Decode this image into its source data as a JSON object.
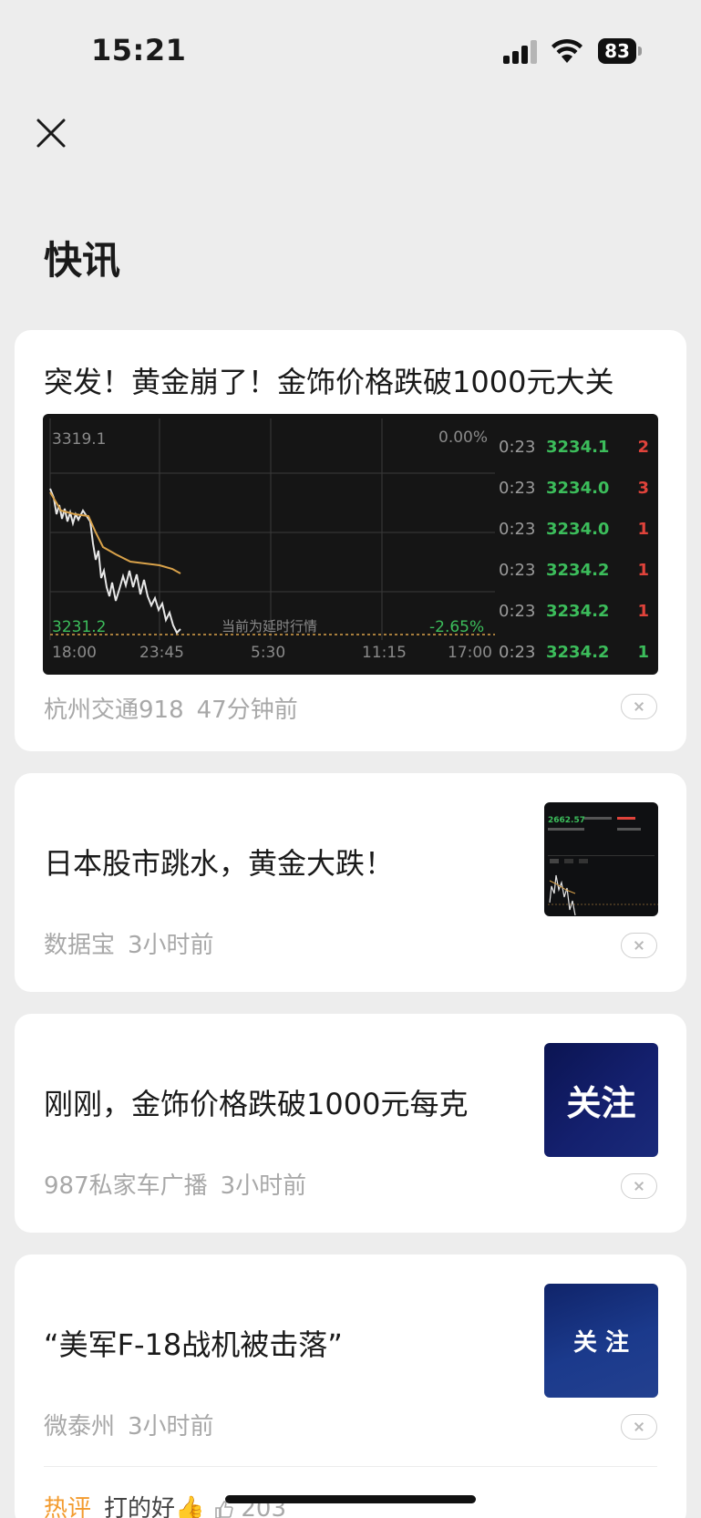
{
  "status_bar": {
    "time": "15:21",
    "battery": "83"
  },
  "page": {
    "title": "快讯"
  },
  "cards": [
    {
      "title": "突发！黄金崩了！金饰价格跌破1000元大关",
      "source": "杭州交通918",
      "time": "47分钟前",
      "chart": {
        "high_label": "3319.1",
        "low_label": "3231.2",
        "pct_top": "0.00%",
        "pct_bottom": "-2.65%",
        "delay_note": "当前为延时行情",
        "x_ticks": [
          "18:00",
          "23:45",
          "5:30",
          "11:15",
          "17:00"
        ],
        "ticks": [
          {
            "time": "0:23",
            "price": "3234.1",
            "vol": "2"
          },
          {
            "time": "0:23",
            "price": "3234.0",
            "vol": "3"
          },
          {
            "time": "0:23",
            "price": "3234.0",
            "vol": "1"
          },
          {
            "time": "0:23",
            "price": "3234.2",
            "vol": "1"
          },
          {
            "time": "0:23",
            "price": "3234.2",
            "vol": "1"
          },
          {
            "time": "0:23",
            "price": "3234.2",
            "vol": "1"
          }
        ],
        "colors": {
          "price_line": "#e8e8e8",
          "avg_line": "#d9a24a",
          "up": "#e0433b",
          "down": "#3cbd5b"
        }
      }
    },
    {
      "title": "日本股市跳水，黄金大跌！",
      "source": "数据宝",
      "time": "3小时前",
      "thumb_value": "2662.57"
    },
    {
      "title": "刚刚，金饰价格跌破1000元每克",
      "source": "987私家车广播",
      "time": "3小时前",
      "thumb_text": "关注"
    },
    {
      "title": "“美军F-18战机被击落”",
      "source": "微泰州",
      "time": "3小时前",
      "thumb_text": "关 注",
      "hot": {
        "tag": "热评",
        "text": "打的好👍",
        "count": "203"
      }
    }
  ]
}
